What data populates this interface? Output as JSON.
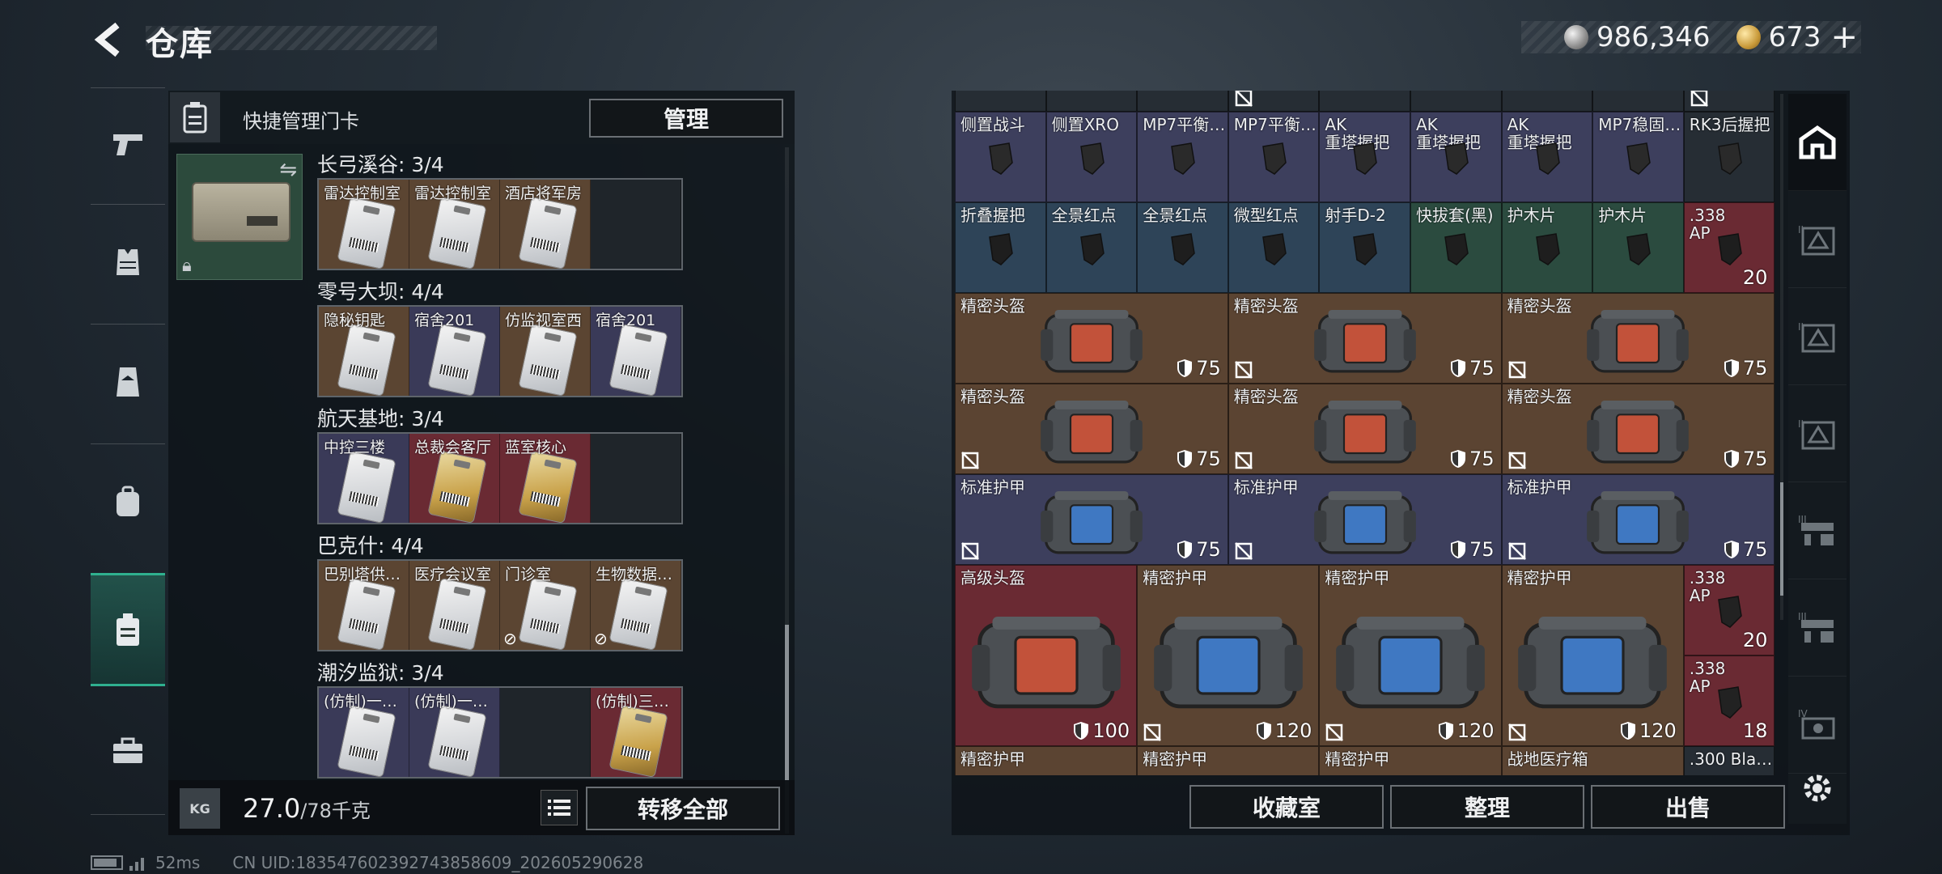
{
  "header": {
    "title": "仓库",
    "currency_silver": "986,346",
    "currency_gold": "673"
  },
  "left_nav": [
    "weapons-tab",
    "armor-tab",
    "backpack-tab",
    "chest-rig-tab",
    "keycard-tab",
    "case-tab"
  ],
  "left_panel": {
    "header_title": "快捷管理门卡",
    "manage_label": "管理",
    "groups": [
      {
        "title": "长弓溪谷: 3/4",
        "cards": [
          {
            "label": "雷达控制室",
            "bg": "brown"
          },
          {
            "label": "雷达控制室",
            "bg": "brown"
          },
          {
            "label": "酒店将军房",
            "bg": "brown"
          },
          {
            "label": "",
            "bg": "empty"
          }
        ]
      },
      {
        "title": "零号大坝: 4/4",
        "cards": [
          {
            "label": "隐秘钥匙",
            "bg": "brown"
          },
          {
            "label": "宿舍201",
            "bg": "purple"
          },
          {
            "label": "仿监视室西",
            "bg": "brown"
          },
          {
            "label": "宿舍201",
            "bg": "purple"
          }
        ]
      },
      {
        "title": "航天基地: 3/4",
        "cards": [
          {
            "label": "中控三楼",
            "bg": "purple"
          },
          {
            "label": "总裁会客厅",
            "bg": "red"
          },
          {
            "label": "蓝室核心",
            "bg": "red"
          },
          {
            "label": "",
            "bg": "empty"
          }
        ]
      },
      {
        "title": "巴克什: 4/4",
        "cards": [
          {
            "label": "巴别塔供…",
            "bg": "brown"
          },
          {
            "label": "医疗会议室",
            "bg": "brown"
          },
          {
            "label": "门诊室",
            "bg": "brown"
          },
          {
            "label": "生物数据…",
            "bg": "brown"
          }
        ]
      },
      {
        "title": "潮汐监狱: 3/4",
        "cards": [
          {
            "label": "(仿制)一…",
            "bg": "purple"
          },
          {
            "label": "(仿制)一…",
            "bg": "purple"
          },
          {
            "label": "",
            "bg": "empty"
          },
          {
            "label": "(仿制)三…",
            "bg": "red"
          }
        ]
      }
    ],
    "weight_current": "27.0",
    "weight_max": "/78千克",
    "kg_label": "KG",
    "transfer_label": "转移全部"
  },
  "right_panel": {
    "row1": [
      "侧置战斗",
      "侧置XRO",
      "MP7平衡…",
      "MP7平衡…",
      "AK\n重塔握把",
      "AK\n重塔握把",
      "AK\n重塔握把",
      "MP7稳固…",
      "RK3后握把"
    ],
    "row2": [
      {
        "name": "折叠握把",
        "c": "blue"
      },
      {
        "name": "全景红点",
        "c": "blue"
      },
      {
        "name": "全景红点",
        "c": "blue"
      },
      {
        "name": "微型红点",
        "c": "blue"
      },
      {
        "name": "射手D-2",
        "c": "blue"
      },
      {
        "name": "快拔套(黑)",
        "c": "green"
      },
      {
        "name": "护木片",
        "c": "green"
      },
      {
        "name": "护木片",
        "c": "green"
      },
      {
        "name": ".338\nAP",
        "c": "red",
        "qty": "20"
      }
    ],
    "helmet_rows": [
      [
        {
          "name": "精密头盔",
          "dur": "75"
        },
        {
          "name": "精密头盔",
          "dur": "75"
        },
        {
          "name": "精密头盔",
          "dur": "75"
        }
      ],
      [
        {
          "name": "精密头盔",
          "dur": "75"
        },
        {
          "name": "精密头盔",
          "dur": "75"
        },
        {
          "name": "精密头盔",
          "dur": "75"
        }
      ],
      [
        {
          "name": "标准护甲",
          "dur": "75"
        },
        {
          "name": "标准护甲",
          "dur": "75"
        },
        {
          "name": "标准护甲",
          "dur": "75"
        }
      ]
    ],
    "big_row": [
      {
        "name": "高级头盔",
        "dur": "100",
        "c": "red"
      },
      {
        "name": "精密护甲",
        "dur": "120",
        "c": "brown"
      },
      {
        "name": "精密护甲",
        "dur": "120",
        "c": "brown"
      },
      {
        "name": "精密护甲",
        "dur": "120",
        "c": "brown"
      }
    ],
    "ammo_right": [
      {
        "name": ".338\nAP",
        "qty": "20"
      },
      {
        "name": ".338\nAP",
        "qty": "18"
      }
    ],
    "bottom_row": [
      "精密护甲",
      "精密护甲",
      "精密护甲",
      "战地医疗箱",
      ".300 Bla…"
    ],
    "buttons": {
      "collection": "收藏室",
      "sort": "整理",
      "sell": "出售"
    }
  },
  "status": {
    "ping": "52ms",
    "uid": "CN UID:18354760239274385860​9_202605290628"
  },
  "colors": {
    "accent_active": "#2fb08f",
    "purple": "#3d3f5d",
    "blue": "#2e4458",
    "green": "#2b4b3f",
    "brown": "#5b4432",
    "red": "#6a2a33"
  }
}
